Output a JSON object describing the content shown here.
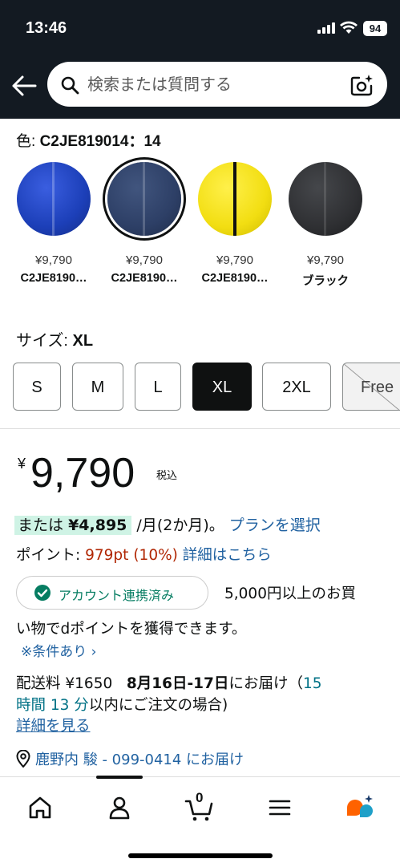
{
  "status_bar": {
    "time": "13:46",
    "battery": "94"
  },
  "header": {
    "search_placeholder": "検索または質問する"
  },
  "color_selector": {
    "label": "色: ",
    "selected": "C2JE819014：14",
    "options": [
      {
        "price": "¥9,790",
        "name": "C2JE8190…",
        "color": "#1c3fb8",
        "selected": false
      },
      {
        "price": "¥9,790",
        "name": "C2JE8190…",
        "color": "#2d3f66",
        "selected": true
      },
      {
        "price": "¥9,790",
        "name": "C2JE8190…",
        "color": "#f2de12",
        "selected": false
      },
      {
        "price": "¥9,790",
        "name": "ブラック",
        "color": "#2f3033",
        "selected": false
      }
    ]
  },
  "size_selector": {
    "label": "サイズ: ",
    "selected": "XL",
    "options": [
      {
        "label": "S",
        "state": "available"
      },
      {
        "label": "M",
        "state": "available"
      },
      {
        "label": "L",
        "state": "available"
      },
      {
        "label": "XL",
        "state": "selected"
      },
      {
        "label": "2XL",
        "state": "available"
      },
      {
        "label": "Free",
        "state": "unavailable"
      }
    ]
  },
  "price": {
    "currency": "¥",
    "amount": "9,790",
    "tax_note": "税込"
  },
  "installment": {
    "prefix": "または",
    "amount": "¥4,895",
    "suffix": " /月(2か月)。",
    "link": "プランを選択"
  },
  "points": {
    "label": "ポイント: ",
    "value": "979pt",
    "percent": "(10%)",
    "link": "詳細はこちら"
  },
  "dpoint": {
    "badge": "アカウント連携済み",
    "text_line1": "5,000円以上のお買",
    "text_line2": "い物でdポイントを獲得できます。",
    "condition_link": "※条件あり ›"
  },
  "shipping": {
    "fee": "配送料 ¥1650",
    "date": "8月16日-17日",
    "date_suffix": "にお届け（",
    "cutoff_a": "15",
    "cutoff_b": "時間 13 分",
    "cutoff_suffix": "以内にご注文の場合)",
    "details_link": "詳細を見る"
  },
  "location": {
    "text": "鹿野内 駿 - 099-0414 にお届け"
  },
  "bottom_nav": {
    "cart_count": "0",
    "accent": "#FF6200"
  },
  "colors": {
    "nav_bg": "#131A22",
    "link_blue": "#2162A1",
    "teal": "#007185",
    "price_red": "#B12704",
    "installment_bg": "#CFF3E5"
  }
}
